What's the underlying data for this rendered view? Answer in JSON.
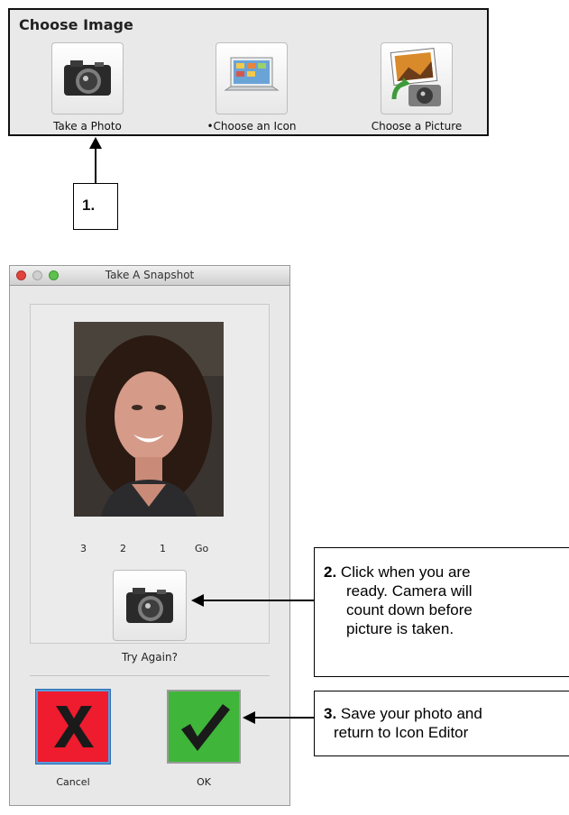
{
  "choose_image": {
    "title": "Choose Image",
    "options": [
      {
        "label": "Take a Photo",
        "icon": "camera-icon"
      },
      {
        "label": "•Choose an Icon",
        "icon": "laptop-icon"
      },
      {
        "label": "Choose a Picture",
        "icon": "picture-camera-icon"
      }
    ]
  },
  "annotation_1": {
    "label": "1."
  },
  "window": {
    "title": "Take A Snapshot",
    "countdown": [
      "3",
      "2",
      "1",
      "Go"
    ],
    "try_again": "Try Again?",
    "cancel_label": "Cancel",
    "ok_label": "OK"
  },
  "annotation_2": {
    "number": "2.",
    "lines": [
      "Click when you are",
      "ready. Camera will",
      "count down before",
      "picture is taken."
    ]
  },
  "annotation_3": {
    "number": "3.",
    "lines": [
      "Save your photo and",
      "return to Icon Editor"
    ]
  },
  "colors": {
    "cancel": "#ee1c2e",
    "ok": "#3fb53a",
    "close": "#e0443e",
    "zoom": "#5fc14d"
  }
}
